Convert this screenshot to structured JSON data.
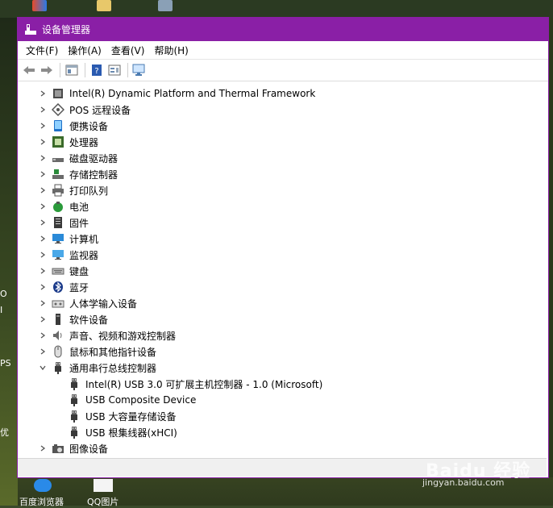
{
  "window": {
    "title": "设备管理器",
    "accent": "#8a1fa6"
  },
  "menu": [
    "文件(F)",
    "操作(A)",
    "查看(V)",
    "帮助(H)"
  ],
  "tree": [
    {
      "label": "Intel(R) Dynamic Platform and Thermal Framework",
      "icon": "chip-icon",
      "level": 0,
      "expanded": false
    },
    {
      "label": "POS 远程设备",
      "icon": "pos-icon",
      "level": 0,
      "expanded": false
    },
    {
      "label": "便携设备",
      "icon": "portable-device-icon",
      "level": 0,
      "expanded": false
    },
    {
      "label": "处理器",
      "icon": "processor-icon",
      "level": 0,
      "expanded": false
    },
    {
      "label": "磁盘驱动器",
      "icon": "disk-drive-icon",
      "level": 0,
      "expanded": false
    },
    {
      "label": "存储控制器",
      "icon": "storage-controller-icon",
      "level": 0,
      "expanded": false
    },
    {
      "label": "打印队列",
      "icon": "printer-icon",
      "level": 0,
      "expanded": false
    },
    {
      "label": "电池",
      "icon": "battery-icon",
      "level": 0,
      "expanded": false
    },
    {
      "label": "固件",
      "icon": "firmware-icon",
      "level": 0,
      "expanded": false
    },
    {
      "label": "计算机",
      "icon": "computer-icon",
      "level": 0,
      "expanded": false
    },
    {
      "label": "监视器",
      "icon": "monitor-icon",
      "level": 0,
      "expanded": false
    },
    {
      "label": "键盘",
      "icon": "keyboard-icon",
      "level": 0,
      "expanded": false
    },
    {
      "label": "蓝牙",
      "icon": "bluetooth-icon",
      "level": 0,
      "expanded": false
    },
    {
      "label": "人体学输入设备",
      "icon": "hid-icon",
      "level": 0,
      "expanded": false
    },
    {
      "label": "软件设备",
      "icon": "software-device-icon",
      "level": 0,
      "expanded": false
    },
    {
      "label": "声音、视频和游戏控制器",
      "icon": "speaker-icon",
      "level": 0,
      "expanded": false
    },
    {
      "label": "鼠标和其他指针设备",
      "icon": "mouse-icon",
      "level": 0,
      "expanded": false
    },
    {
      "label": "通用串行总线控制器",
      "icon": "usb-icon",
      "level": 0,
      "expanded": true
    },
    {
      "label": "Intel(R) USB 3.0 可扩展主机控制器 - 1.0 (Microsoft)",
      "icon": "usb-icon",
      "level": 1
    },
    {
      "label": "USB Composite Device",
      "icon": "usb-icon",
      "level": 1
    },
    {
      "label": "USB 大容量存储设备",
      "icon": "usb-icon",
      "level": 1
    },
    {
      "label": "USB 根集线器(xHCI)",
      "icon": "usb-icon",
      "level": 1
    },
    {
      "label": "图像设备",
      "icon": "camera-icon",
      "level": 0,
      "expanded": false
    }
  ],
  "desktop": {
    "left_fragments": [
      "O",
      "I",
      "PS",
      "优"
    ],
    "bottom_icons": [
      "百度浏览器",
      "QQ图片"
    ],
    "watermark": "Baidu 经验",
    "watermark_url": "jingyan.baidu.com"
  }
}
